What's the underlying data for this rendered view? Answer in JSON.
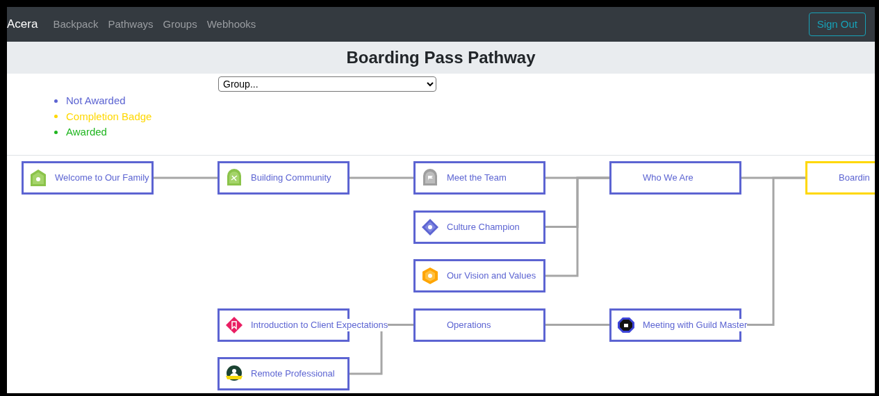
{
  "navbar": {
    "brand": "Acera",
    "links": [
      "Backpack",
      "Pathways",
      "Groups",
      "Webhooks"
    ],
    "sign_out": "Sign Out"
  },
  "header": {
    "title": "Boarding Pass Pathway"
  },
  "group_select": {
    "value": "Group..."
  },
  "legend": [
    {
      "label": "Not Awarded",
      "color": "#5c64d2"
    },
    {
      "label": "Completion Badge",
      "color": "#ffd800"
    },
    {
      "label": "Awarded",
      "color": "#1fb51f"
    }
  ],
  "pathway": {
    "label": "Boardin",
    "color": "#ffd800",
    "badge": false,
    "children": [
      {
        "label": "Who We Are",
        "color": "#5c64d2",
        "badge": false,
        "children": [
          {
            "label": "Meet the Team",
            "color": "#5c64d2",
            "badge": true,
            "children": [
              {
                "label": "Building Community",
                "color": "#5c64d2",
                "badge": true,
                "children": [
                  {
                    "label": "Welcome to Our Family",
                    "color": "#5c64d2",
                    "badge": true
                  }
                ]
              }
            ]
          },
          {
            "label": "Culture Champion",
            "color": "#5c64d2",
            "badge": true
          },
          {
            "label": "Our Vision and Values",
            "color": "#5c64d2",
            "badge": true
          }
        ]
      },
      {
        "label": "Meeting with Guild Master",
        "color": "#5c64d2",
        "badge": true,
        "children": [
          {
            "label": "Operations",
            "color": "#5c64d2",
            "badge": false,
            "children": [
              {
                "label": "Introduction to Client Expectations",
                "color": "#5c64d2",
                "badge": true
              },
              {
                "label": "Remote Professional",
                "color": "#5c64d2",
                "badge": true
              }
            ]
          }
        ]
      }
    ]
  }
}
